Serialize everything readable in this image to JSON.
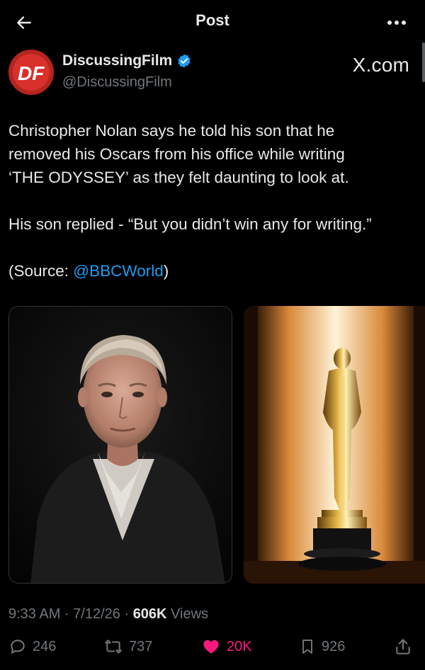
{
  "header": {
    "title": "Post"
  },
  "author": {
    "display_name": "DiscussingFilm",
    "handle": "@DiscussingFilm",
    "source": "X.com",
    "avatar_letters": "DF"
  },
  "tweet": {
    "line1": "Christopher Nolan says he told his son that he",
    "line2": "removed his Oscars from his office while writing",
    "line3": "‘THE ODYSSEY’ as they felt daunting to look at.",
    "line4": "His son replied - “But you didn’t win any for writing.”",
    "source_prefix": "(Source: ",
    "source_mention": "@BBCWorld",
    "source_suffix": ")"
  },
  "meta": {
    "time": "9:33 AM",
    "sep1": " · ",
    "date": "7/12/26",
    "sep2": " · ",
    "views_count": "606K",
    "views_label": " Views"
  },
  "actions": {
    "replies": "246",
    "reposts": "737",
    "likes": "20K",
    "bookmarks": "926"
  },
  "colors": {
    "background": "#000000",
    "text": "#e7e9ea",
    "muted": "#71767b",
    "link": "#1d9bf0",
    "like": "#f91880",
    "verified": "#1d9bf0"
  },
  "icons": [
    "back-arrow-icon",
    "more-dots-icon",
    "verified-badge-icon",
    "reply-icon",
    "repost-icon",
    "like-heart-icon",
    "bookmark-icon",
    "share-icon"
  ]
}
